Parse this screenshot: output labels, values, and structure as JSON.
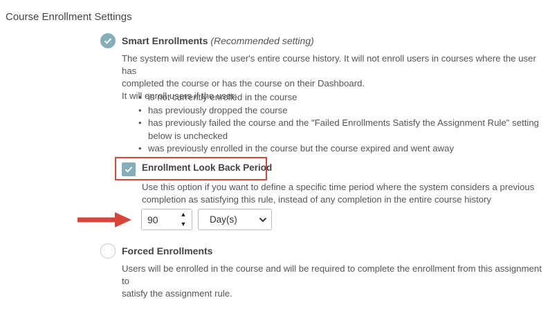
{
  "section": {
    "title": "Course Enrollment Settings"
  },
  "smart": {
    "title": "Smart Enrollments",
    "note": "(Recommended setting)",
    "description_line1": "The system will review the user's entire course history. It will not enroll users in courses where the user has",
    "description_line2": "completed the course or has the course on their Dashboard.",
    "will_enroll": "It will enroll users if the user:",
    "conditions": [
      "is not currently enrolled in the course",
      "has previously dropped the course",
      "has previously failed the course and the \"Failed Enrollments Satisfy the Assignment Rule\" setting",
      "below is unchecked",
      "was previously enrolled in the course but the course expired and went away"
    ]
  },
  "lookback": {
    "label": "Enrollment Look Back Period",
    "checked": true,
    "help_line1": "Use this option if you want to define a specific time period where the system considers a previous",
    "help_line2": "completion as satisfying this rule, instead of any completion in the entire course history",
    "value": "90",
    "unit": "Day(s)"
  },
  "forced": {
    "title": "Forced Enrollments",
    "description_line1": "Users will be enrolled in the course and will be required to complete the enrollment from this assignment to",
    "description_line2": "satisfy the assignment rule."
  },
  "colors": {
    "accent": "#86aeba",
    "highlight": "#d7443a",
    "text": "#555555"
  },
  "icons": {
    "radio_selected": "check-icon",
    "stepper_up": "triangle-up-icon",
    "stepper_down": "triangle-down-icon",
    "select": "chevron-down-icon",
    "pointer": "red-arrow-icon"
  }
}
